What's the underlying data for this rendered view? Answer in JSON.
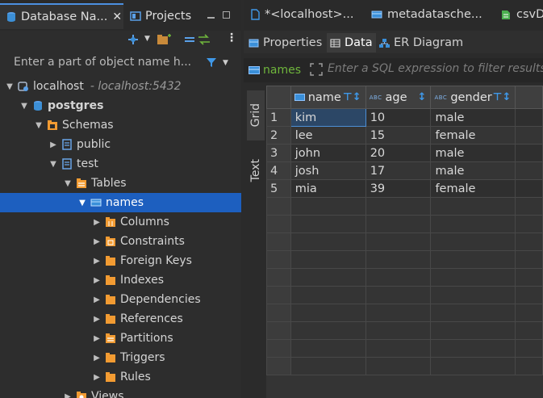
{
  "left_panel": {
    "tabs": {
      "database_navigator": "Database Na...",
      "projects": "Projects"
    },
    "filter_placeholder": "Enter a part of object name h...",
    "tree": [
      {
        "label": "localhost",
        "hint": "- localhost:5432",
        "expanded": true
      },
      {
        "label": "postgres",
        "expanded": true
      },
      {
        "label": "Schemas",
        "expanded": true
      },
      {
        "label": "public",
        "expanded": false
      },
      {
        "label": "test",
        "expanded": true
      },
      {
        "label": "Tables",
        "expanded": true
      },
      {
        "label": "names",
        "expanded": true,
        "selected": true
      },
      {
        "label": "Columns"
      },
      {
        "label": "Constraints"
      },
      {
        "label": "Foreign Keys"
      },
      {
        "label": "Indexes"
      },
      {
        "label": "Dependencies"
      },
      {
        "label": "References"
      },
      {
        "label": "Partitions"
      },
      {
        "label": "Triggers"
      },
      {
        "label": "Rules"
      },
      {
        "label": "Views"
      }
    ]
  },
  "right_panel": {
    "editor_tabs": [
      "*<localhost>...",
      "metadatasche...",
      "csvD"
    ],
    "sub_tabs": [
      "Properties",
      "Data",
      "ER Diagram"
    ],
    "active_sub_tab": "Data",
    "table_chip": "names",
    "sql_filter_placeholder": "Enter a SQL expression to filter results",
    "side_tabs": [
      "Grid",
      "Text"
    ],
    "grid": {
      "columns": [
        "name",
        "age",
        "gender"
      ],
      "rows": [
        {
          "num": "1",
          "name": "kim",
          "age": "10",
          "gender": "male"
        },
        {
          "num": "2",
          "name": "lee",
          "age": "15",
          "gender": "female"
        },
        {
          "num": "3",
          "name": "john",
          "age": "20",
          "gender": "male"
        },
        {
          "num": "4",
          "name": "josh",
          "age": "17",
          "gender": "male"
        },
        {
          "num": "5",
          "name": "mia",
          "age": "39",
          "gender": "female"
        }
      ]
    }
  },
  "colors": {
    "selection": "#1d5fbf",
    "folder": "#f29b32",
    "table_chip": "#6fb63c",
    "sort_icon": "#3f98e8"
  }
}
